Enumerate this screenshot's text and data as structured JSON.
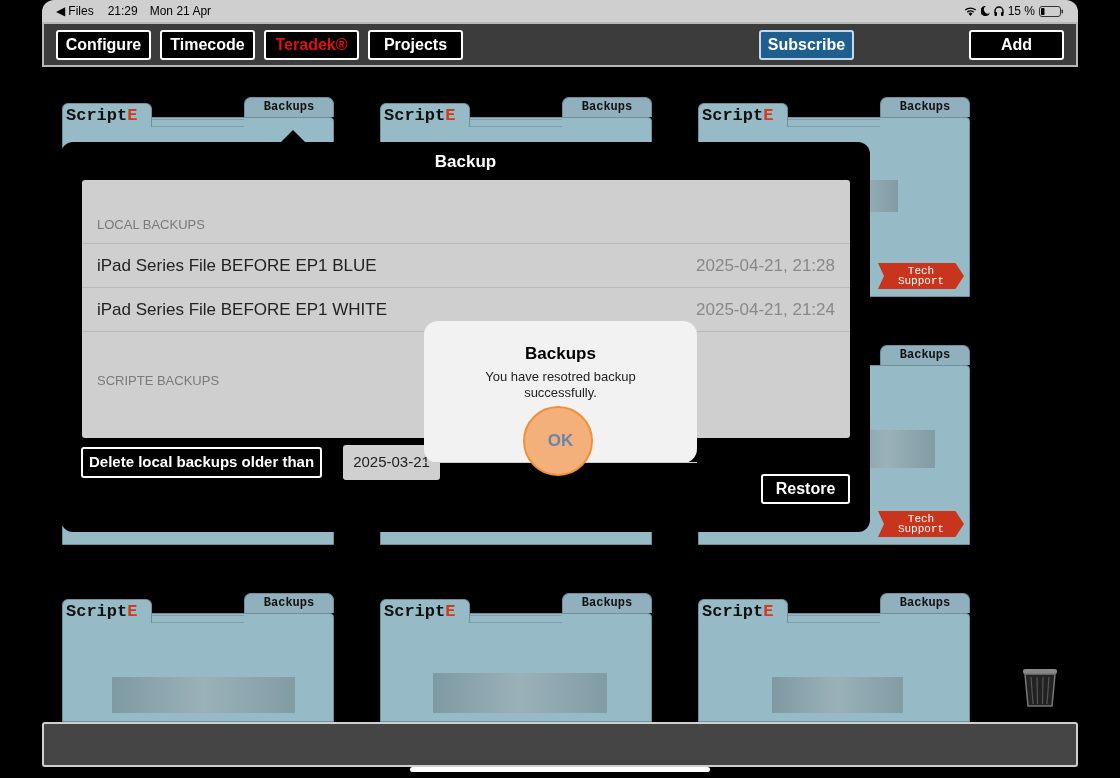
{
  "status_bar": {
    "back_link": "◀ Files",
    "time": "21:29",
    "date": "Mon 21 Apr",
    "battery": "15 %"
  },
  "toolbar": {
    "buttons": [
      {
        "label": "Configure",
        "kind": "plain"
      },
      {
        "label": "Timecode",
        "kind": "plain"
      },
      {
        "label": "Teradek®",
        "kind": "alert"
      },
      {
        "label": "Projects",
        "kind": "plain"
      },
      {
        "label": "Subscribe",
        "kind": "primary"
      },
      {
        "label": "Add",
        "kind": "plain"
      }
    ]
  },
  "folders": [
    {
      "kind": "folder",
      "logo": "Script",
      "logo_accent": "E",
      "tab": "Backups"
    },
    {
      "kind": "folder",
      "logo": "Script",
      "logo_accent": "E",
      "tab": "Backups"
    },
    {
      "kind": "folder",
      "logo": "Script",
      "logo_accent": "E",
      "tab": "Backups",
      "blurred": true,
      "tech_support": "Tech Support"
    },
    {
      "kind": "folder"
    },
    {
      "kind": "folder"
    },
    {
      "kind": "folder",
      "tab": "Backups",
      "blurred": true,
      "tech_support": "Tech Support"
    },
    {
      "kind": "folder",
      "logo": "Script",
      "logo_accent": "E",
      "tab": "Backups",
      "blurred": true
    },
    {
      "kind": "folder",
      "logo": "Script",
      "logo_accent": "E",
      "tab": "Backups",
      "blurred": true
    },
    {
      "kind": "folder",
      "logo": "Script",
      "logo_accent": "E",
      "tab": "Backups",
      "blurred": true
    }
  ],
  "popover": {
    "title": "Backup",
    "sections": [
      {
        "header": "LOCAL BACKUPS",
        "rows": [
          {
            "name": "iPad Series File BEFORE EP1 BLUE",
            "date": "2025-04-21, 21:28"
          },
          {
            "name": "iPad Series File BEFORE EP1 WHITE",
            "date": "2025-04-21, 21:24"
          }
        ]
      },
      {
        "header": "SCRIPTE BACKUPS"
      }
    ],
    "delete_button": "Delete local backups older than",
    "cutoff_date": "2025-03-21",
    "restore_button": "Restore"
  },
  "alert": {
    "title": "Backups",
    "message": "You have resotred backup successfully.",
    "button": "OK",
    "touched": true
  }
}
